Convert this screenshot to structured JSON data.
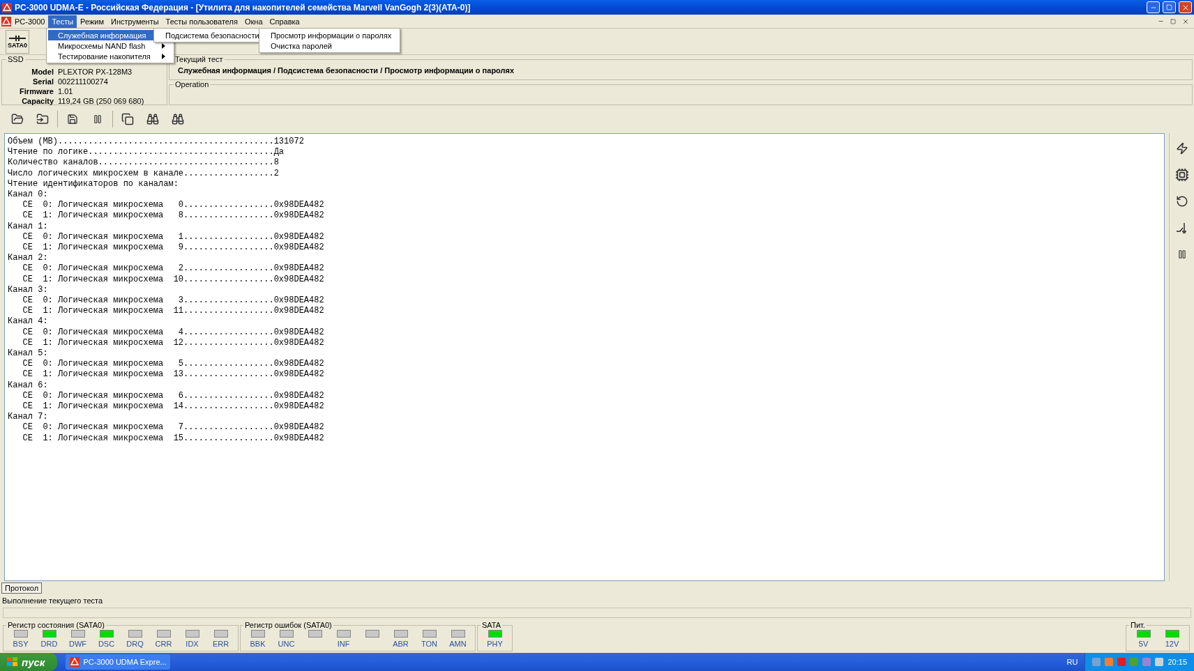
{
  "window": {
    "title": "PC-3000 UDMA-E - Российская Федерация - [Утилита для накопителей семейства Marvell VanGogh 2(3)(ATA-0)]"
  },
  "menu_bar": [
    {
      "label": "PC-3000",
      "selected": false
    },
    {
      "label": "Тесты",
      "selected": true
    },
    {
      "label": "Режим",
      "selected": false
    },
    {
      "label": "Инструменты",
      "selected": false
    },
    {
      "label": "Тесты пользователя",
      "selected": false
    },
    {
      "label": "Окна",
      "selected": false
    },
    {
      "label": "Справка",
      "selected": false
    }
  ],
  "open_menus": [
    [
      {
        "label": "Служебная информация",
        "selected": true,
        "has_submenu": true
      },
      {
        "label": "Микросхемы NAND flash",
        "selected": false,
        "has_submenu": true
      },
      {
        "label": "Тестирование накопителя",
        "selected": false,
        "has_submenu": true
      }
    ],
    [
      {
        "label": "Подсистема безопасности",
        "selected": false,
        "has_submenu": true
      }
    ],
    [
      {
        "label": "Просмотр информации о паролях",
        "selected": false,
        "has_submenu": false
      },
      {
        "label": "Очистка паролей",
        "selected": false,
        "has_submenu": false
      }
    ]
  ],
  "toolbar": {
    "device_button": "SATA0"
  },
  "drive_info": {
    "title": "SSD",
    "fields": [
      {
        "label": "Model",
        "value": "PLEXTOR PX-128M3"
      },
      {
        "label": "Serial",
        "value": "002211100274"
      },
      {
        "label": "Firmware",
        "value": "1.01"
      },
      {
        "label": "Capacity",
        "value": "119,24 GB (250 069 680)"
      }
    ]
  },
  "current_test": {
    "title": "Текущий тест",
    "path": "Служебная информация / Подсистема безопасности / Просмотр информации о паролях"
  },
  "operation": {
    "title": "Operation"
  },
  "log_lines": [
    "Объем (MB)...........................................131072",
    "Чтение по логике.....................................Да",
    "Количество каналов...................................8",
    "Число логических микросхем в канале..................2",
    "Чтение идентификаторов по каналам:",
    "Канал 0:",
    "   CE  0: Логическая микросхема   0..................0x98DEA482",
    "   CE  1: Логическая микросхема   8..................0x98DEA482",
    "Канал 1:",
    "   CE  0: Логическая микросхема   1..................0x98DEA482",
    "   CE  1: Логическая микросхема   9..................0x98DEA482",
    "Канал 2:",
    "   CE  0: Логическая микросхема   2..................0x98DEA482",
    "   CE  1: Логическая микросхема  10..................0x98DEA482",
    "Канал 3:",
    "   CE  0: Логическая микросхема   3..................0x98DEA482",
    "   CE  1: Логическая микросхема  11..................0x98DEA482",
    "Канал 4:",
    "   CE  0: Логическая микросхема   4..................0x98DEA482",
    "   CE  1: Логическая микросхема  12..................0x98DEA482",
    "Канал 5:",
    "   CE  0: Логическая микросхема   5..................0x98DEA482",
    "   CE  1: Логическая микросхема  13..................0x98DEA482",
    "Канал 6:",
    "   CE  0: Логическая микросхема   6..................0x98DEA482",
    "   CE  1: Логическая микросхема  14..................0x98DEA482",
    "Канал 7:",
    "   CE  0: Логическая микросхема   7..................0x98DEA482",
    "   CE  1: Логическая микросхема  15..................0x98DEA482"
  ],
  "protocol_tab": {
    "label": "Протокол",
    "selected": true
  },
  "progress": {
    "label": "Выполнение текущего теста",
    "level": 0
  },
  "status_register": {
    "title": "Регистр состояния (SATA0)",
    "flags": [
      {
        "label": "BSY",
        "on": false
      },
      {
        "label": "DRD",
        "on": true
      },
      {
        "label": "DWF",
        "on": false
      },
      {
        "label": "DSC",
        "on": true
      },
      {
        "label": "DRQ",
        "on": false
      },
      {
        "label": "CRR",
        "on": false
      },
      {
        "label": "IDX",
        "on": false
      },
      {
        "label": "ERR",
        "on": false
      }
    ]
  },
  "error_register": {
    "title": "Регистр ошибок  (SATA0)",
    "flags": [
      {
        "label": "BBK",
        "on": false
      },
      {
        "label": "UNC",
        "on": false
      },
      {
        "on": false
      },
      {
        "label": "INF",
        "on": false
      },
      {
        "on": false
      },
      {
        "label": "ABR",
        "on": false
      },
      {
        "label": "TON",
        "on": false
      },
      {
        "label": "AMN",
        "on": false
      }
    ]
  },
  "sata": {
    "title": "SATA",
    "flags": [
      {
        "label": "PHY",
        "on": true
      }
    ]
  },
  "power": {
    "title": "Пит.",
    "flags": [
      {
        "label": "5V",
        "on": true
      },
      {
        "label": "12V",
        "on": true
      }
    ]
  },
  "taskbar": {
    "start": "пуск",
    "tasks": [
      {
        "label": "PC-3000 UDMA Expre...",
        "selected": false
      }
    ],
    "language": "RU",
    "time": "20:15"
  }
}
